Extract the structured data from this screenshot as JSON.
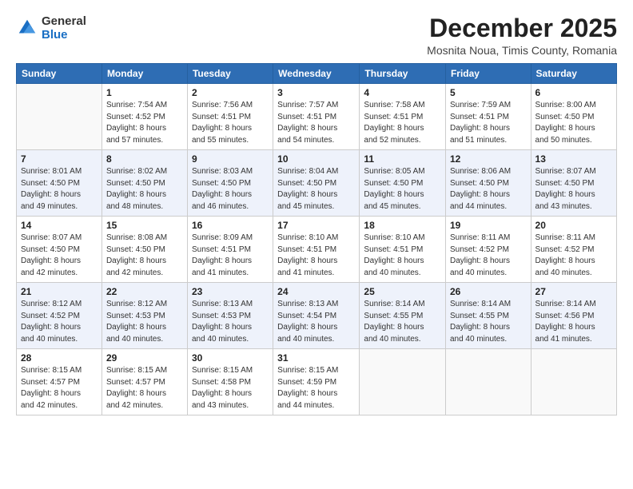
{
  "logo": {
    "general": "General",
    "blue": "Blue"
  },
  "title": "December 2025",
  "subtitle": "Mosnita Noua, Timis County, Romania",
  "days_header": [
    "Sunday",
    "Monday",
    "Tuesday",
    "Wednesday",
    "Thursday",
    "Friday",
    "Saturday"
  ],
  "weeks": [
    [
      {
        "day": "",
        "info": ""
      },
      {
        "day": "1",
        "info": "Sunrise: 7:54 AM\nSunset: 4:52 PM\nDaylight: 8 hours\nand 57 minutes."
      },
      {
        "day": "2",
        "info": "Sunrise: 7:56 AM\nSunset: 4:51 PM\nDaylight: 8 hours\nand 55 minutes."
      },
      {
        "day": "3",
        "info": "Sunrise: 7:57 AM\nSunset: 4:51 PM\nDaylight: 8 hours\nand 54 minutes."
      },
      {
        "day": "4",
        "info": "Sunrise: 7:58 AM\nSunset: 4:51 PM\nDaylight: 8 hours\nand 52 minutes."
      },
      {
        "day": "5",
        "info": "Sunrise: 7:59 AM\nSunset: 4:51 PM\nDaylight: 8 hours\nand 51 minutes."
      },
      {
        "day": "6",
        "info": "Sunrise: 8:00 AM\nSunset: 4:50 PM\nDaylight: 8 hours\nand 50 minutes."
      }
    ],
    [
      {
        "day": "7",
        "info": "Sunrise: 8:01 AM\nSunset: 4:50 PM\nDaylight: 8 hours\nand 49 minutes."
      },
      {
        "day": "8",
        "info": "Sunrise: 8:02 AM\nSunset: 4:50 PM\nDaylight: 8 hours\nand 48 minutes."
      },
      {
        "day": "9",
        "info": "Sunrise: 8:03 AM\nSunset: 4:50 PM\nDaylight: 8 hours\nand 46 minutes."
      },
      {
        "day": "10",
        "info": "Sunrise: 8:04 AM\nSunset: 4:50 PM\nDaylight: 8 hours\nand 45 minutes."
      },
      {
        "day": "11",
        "info": "Sunrise: 8:05 AM\nSunset: 4:50 PM\nDaylight: 8 hours\nand 45 minutes."
      },
      {
        "day": "12",
        "info": "Sunrise: 8:06 AM\nSunset: 4:50 PM\nDaylight: 8 hours\nand 44 minutes."
      },
      {
        "day": "13",
        "info": "Sunrise: 8:07 AM\nSunset: 4:50 PM\nDaylight: 8 hours\nand 43 minutes."
      }
    ],
    [
      {
        "day": "14",
        "info": "Sunrise: 8:07 AM\nSunset: 4:50 PM\nDaylight: 8 hours\nand 42 minutes."
      },
      {
        "day": "15",
        "info": "Sunrise: 8:08 AM\nSunset: 4:50 PM\nDaylight: 8 hours\nand 42 minutes."
      },
      {
        "day": "16",
        "info": "Sunrise: 8:09 AM\nSunset: 4:51 PM\nDaylight: 8 hours\nand 41 minutes."
      },
      {
        "day": "17",
        "info": "Sunrise: 8:10 AM\nSunset: 4:51 PM\nDaylight: 8 hours\nand 41 minutes."
      },
      {
        "day": "18",
        "info": "Sunrise: 8:10 AM\nSunset: 4:51 PM\nDaylight: 8 hours\nand 40 minutes."
      },
      {
        "day": "19",
        "info": "Sunrise: 8:11 AM\nSunset: 4:52 PM\nDaylight: 8 hours\nand 40 minutes."
      },
      {
        "day": "20",
        "info": "Sunrise: 8:11 AM\nSunset: 4:52 PM\nDaylight: 8 hours\nand 40 minutes."
      }
    ],
    [
      {
        "day": "21",
        "info": "Sunrise: 8:12 AM\nSunset: 4:52 PM\nDaylight: 8 hours\nand 40 minutes."
      },
      {
        "day": "22",
        "info": "Sunrise: 8:12 AM\nSunset: 4:53 PM\nDaylight: 8 hours\nand 40 minutes."
      },
      {
        "day": "23",
        "info": "Sunrise: 8:13 AM\nSunset: 4:53 PM\nDaylight: 8 hours\nand 40 minutes."
      },
      {
        "day": "24",
        "info": "Sunrise: 8:13 AM\nSunset: 4:54 PM\nDaylight: 8 hours\nand 40 minutes."
      },
      {
        "day": "25",
        "info": "Sunrise: 8:14 AM\nSunset: 4:55 PM\nDaylight: 8 hours\nand 40 minutes."
      },
      {
        "day": "26",
        "info": "Sunrise: 8:14 AM\nSunset: 4:55 PM\nDaylight: 8 hours\nand 40 minutes."
      },
      {
        "day": "27",
        "info": "Sunrise: 8:14 AM\nSunset: 4:56 PM\nDaylight: 8 hours\nand 41 minutes."
      }
    ],
    [
      {
        "day": "28",
        "info": "Sunrise: 8:15 AM\nSunset: 4:57 PM\nDaylight: 8 hours\nand 42 minutes."
      },
      {
        "day": "29",
        "info": "Sunrise: 8:15 AM\nSunset: 4:57 PM\nDaylight: 8 hours\nand 42 minutes."
      },
      {
        "day": "30",
        "info": "Sunrise: 8:15 AM\nSunset: 4:58 PM\nDaylight: 8 hours\nand 43 minutes."
      },
      {
        "day": "31",
        "info": "Sunrise: 8:15 AM\nSunset: 4:59 PM\nDaylight: 8 hours\nand 44 minutes."
      },
      {
        "day": "",
        "info": ""
      },
      {
        "day": "",
        "info": ""
      },
      {
        "day": "",
        "info": ""
      }
    ]
  ]
}
